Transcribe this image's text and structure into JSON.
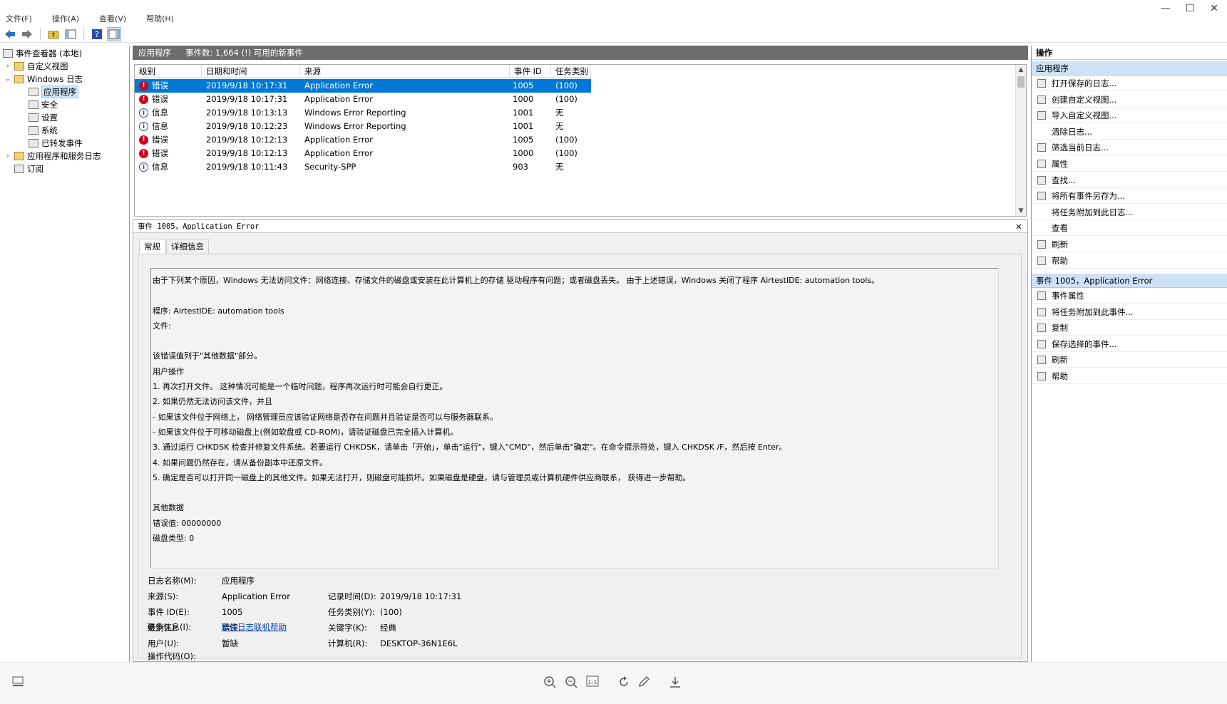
{
  "menu": [
    "文件(F)",
    "操作(A)",
    "查看(V)",
    "帮助(H)"
  ],
  "window_controls": {
    "minimize": "—",
    "maximize": "☐",
    "close": "✕"
  },
  "toolbar": [
    "back-icon",
    "forward-icon",
    "up-folder-icon",
    "show-hide-tree-icon",
    "help-icon",
    "show-hide-action-pane-icon"
  ],
  "tree": {
    "root": "事件查看器 (本地)",
    "custom_views": "自定义视图",
    "windows_logs": "Windows 日志",
    "application": "应用程序",
    "security": "安全",
    "setup": "设置",
    "system": "系统",
    "forwarded": "已转发事件",
    "app_service_logs": "应用程序和服务日志",
    "subscriptions": "订阅"
  },
  "header": {
    "title": "应用程序",
    "count": "事件数: 1,664 (!) 可用的新事件"
  },
  "grid": {
    "columns": [
      "级别",
      "日期和时间",
      "来源",
      "事件 ID",
      "任务类别"
    ],
    "rows": [
      {
        "level": "错误",
        "icon": "error",
        "datetime": "2019/9/18 10:17:31",
        "source": "Application Error",
        "id": "1005",
        "task": "(100)",
        "selected": true
      },
      {
        "level": "错误",
        "icon": "error",
        "datetime": "2019/9/18 10:17:31",
        "source": "Application Error",
        "id": "1000",
        "task": "(100)"
      },
      {
        "level": "信息",
        "icon": "info",
        "datetime": "2019/9/18 10:13:13",
        "source": "Windows Error Reporting",
        "id": "1001",
        "task": "无"
      },
      {
        "level": "信息",
        "icon": "info",
        "datetime": "2019/9/18 10:12:23",
        "source": "Windows Error Reporting",
        "id": "1001",
        "task": "无"
      },
      {
        "level": "错误",
        "icon": "error",
        "datetime": "2019/9/18 10:12:13",
        "source": "Application Error",
        "id": "1005",
        "task": "(100)"
      },
      {
        "level": "错误",
        "icon": "error",
        "datetime": "2019/9/18 10:12:13",
        "source": "Application Error",
        "id": "1000",
        "task": "(100)"
      },
      {
        "level": "信息",
        "icon": "info",
        "datetime": "2019/9/18 10:11:43",
        "source": "Security-SPP",
        "id": "903",
        "task": "无"
      }
    ]
  },
  "detail": {
    "title": "事件 1005，Application Error",
    "close": "✕",
    "tabs": [
      "常规",
      "详细信息"
    ],
    "description": [
      "由于下列某个原因，Windows 无法访问文件：网络连接、存储文件的磁盘或安装在此计算机上的存储 驱动程序有问题；或者磁盘丢失。 由于上述错误，Windows 关闭了程序 AirtestIDE: automation tools。",
      "",
      "程序: AirtestIDE: automation tools",
      "文件:",
      "",
      "该错误值列于\"其他数据\"部分。",
      "用户操作",
      "1. 再次打开文件。 这种情况可能是一个临时问题，程序再次运行时可能会自行更正。",
      "2. 如果仍然无法访问该文件，并且",
      "              - 如果该文件位于网络上， 网络管理员应该验证网络是否存在问题并且验证是否可以与服务器联系。",
      "              - 如果该文件位于可移动磁盘上(例如软盘或 CD-ROM)，请验证磁盘已完全插入计算机。",
      "3. 通过运行 CHKDSK 检查并修复文件系统。若要运行 CHKDSK，请单击「开始」，单击\"运行\"，键入\"CMD\"，然后单击\"确定\"。在命令提示符处，键入 CHKDSK /F，然后按 Enter。",
      "4. 如果问题仍然存在，请从备份副本中还原文件。",
      "5. 确定是否可以打开同一磁盘上的其他文件。如果无法打开，则磁盘可能损坏。如果磁盘是硬盘，请与管理员或计算机硬件供应商联系， 获得进一步帮助。",
      "",
      "其他数据",
      "错误值: 00000000",
      "磁盘类型: 0"
    ],
    "props": {
      "log_name_label": "日志名称(M):",
      "log_name": "应用程序",
      "source_label": "来源(S):",
      "source": "Application Error",
      "logged_label": "记录时间(D):",
      "logged": "2019/9/18 10:17:31",
      "event_id_label": "事件 ID(E):",
      "event_id": "1005",
      "task_label": "任务类别(Y):",
      "task": "(100)",
      "level_label": "级别(L):",
      "level": "错误",
      "keywords_label": "关键字(K):",
      "keywords": "经典",
      "user_label": "用户(U):",
      "user": "暂缺",
      "computer_label": "计算机(R):",
      "computer": "DESKTOP-36N1E6L",
      "opcode_label": "操作代码(O):",
      "more_info_label": "更多信息(I):",
      "more_info_link": "事件日志联机帮助"
    }
  },
  "actions": {
    "title": "操作",
    "section1": "应用程序",
    "items1": [
      "打开保存的日志...",
      "创建自定义视图...",
      "导入自定义视图...",
      "清除日志...",
      "筛选当前日志...",
      "属性",
      "查找...",
      "将所有事件另存为...",
      "将任务附加到此日志...",
      "查看",
      "刷新",
      "帮助"
    ],
    "section2": "事件 1005，Application Error",
    "items2": [
      "事件属性",
      "将任务附加到此事件...",
      "复制",
      "保存选择的事件...",
      "刷新",
      "帮助"
    ]
  },
  "viewer_bar": [
    "zoom-in-icon",
    "zoom-out-icon",
    "actual-size-icon",
    "rotate-icon",
    "edit-icon",
    "download-icon"
  ]
}
